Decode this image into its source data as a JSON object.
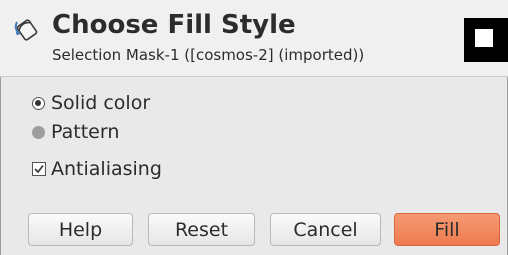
{
  "dialog": {
    "title": "Choose Fill Style",
    "subtitle": "Selection Mask-1 ([cosmos-2] (imported))",
    "header_icon": "bucket-fill-icon",
    "preview_colors": {
      "outer": "#000000",
      "inner": "#ffffff"
    }
  },
  "fill_options": {
    "solid_label": "Solid color",
    "solid_selected": true,
    "pattern_label": "Pattern",
    "pattern_selected": false,
    "antialiasing_label": "Antialiasing",
    "antialiasing_checked": true
  },
  "buttons": {
    "help": "Help",
    "reset": "Reset",
    "cancel": "Cancel",
    "fill": "Fill"
  },
  "colors": {
    "accent": "#ee7a50",
    "background": "#e9e9e9"
  }
}
